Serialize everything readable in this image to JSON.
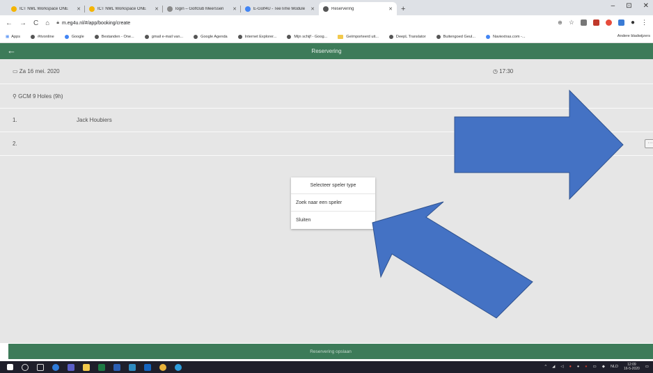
{
  "browser": {
    "tabs": [
      {
        "title": "ICT NML Workspace ONE",
        "color": "#f4b400",
        "active": false
      },
      {
        "title": "ICT NML Workspace ONE",
        "color": "#f4b400",
        "active": false
      },
      {
        "title": "login – Golfclub Meerssen",
        "color": "#888888",
        "active": false
      },
      {
        "title": "E-Golf4U - TeeTime Module",
        "color": "#4285f4",
        "active": false
      },
      {
        "title": "Reservering",
        "color": "#555555",
        "active": true
      }
    ],
    "new_tab": "+",
    "window_controls": [
      "–",
      "⊡",
      "✕"
    ],
    "url": "m.eg4u.nl/#/app/booking/create",
    "bookmarks": [
      "Apps",
      "#itvonline",
      "Google",
      "Bestanden - One...",
      "gmail e-mail van...",
      "Google Agenda",
      "Internet Explorer...",
      "Mijn schijf - Goog...",
      "Geïmporteerd uit...",
      "DeepL Translator",
      "Buitengoed Geul...",
      "Naviextras.com -..."
    ],
    "other_bookmarks": "Andere bladwijzers"
  },
  "app": {
    "title": "Reservering",
    "back_icon": "←",
    "date": "Za 16 mei. 2020",
    "time": "17:30",
    "course": "GCM 9 Holes (9h)",
    "players": [
      {
        "num": "1.",
        "name": "Jack Houbiers"
      },
      {
        "num": "2.",
        "name": ""
      }
    ],
    "more_button": "···",
    "popup": {
      "header": "Selecteer speler type",
      "items": [
        "Zoek naar een speler",
        "Sluiten"
      ]
    },
    "save_button": "Reservering opslaan"
  },
  "taskbar": {
    "language": "NLD",
    "time": "12:09",
    "date": "16-5-2020"
  },
  "colors": {
    "app_green": "#3d7b59",
    "arrow_blue": "#4472c4",
    "arrow_outline": "#2f528f"
  }
}
